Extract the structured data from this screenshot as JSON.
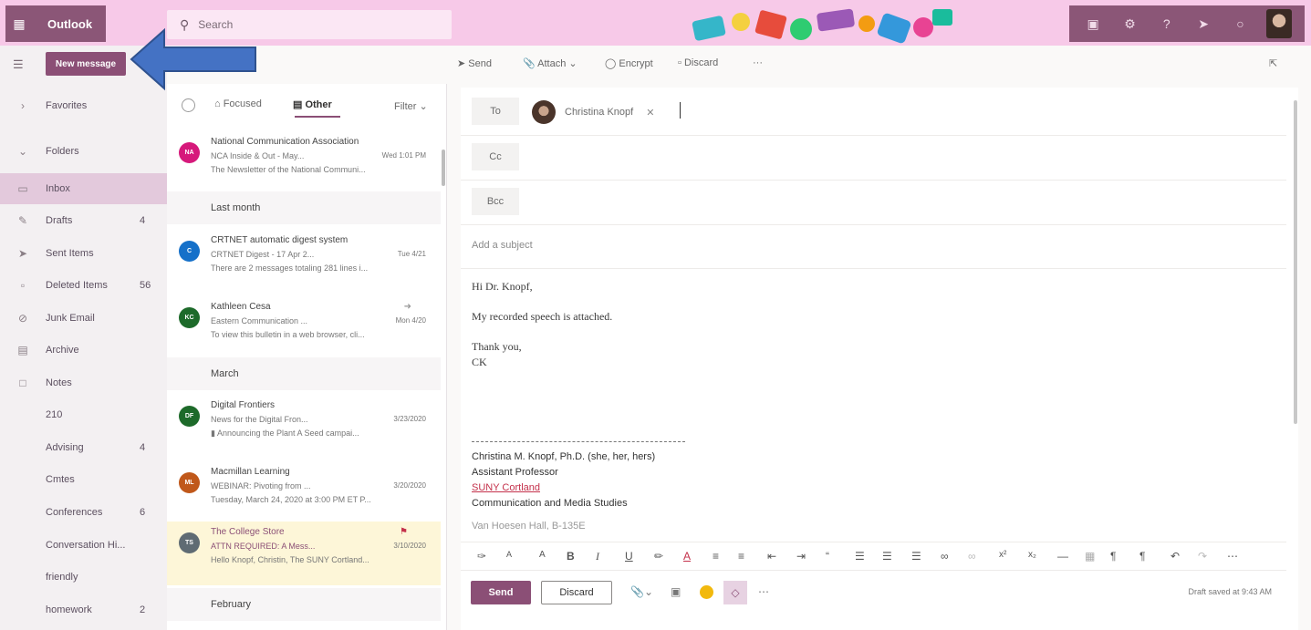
{
  "app": {
    "name": "Outlook"
  },
  "search": {
    "placeholder": "Search"
  },
  "topbar": {
    "icons": [
      "teams-icon",
      "gear-icon",
      "help-icon",
      "megaphone-icon",
      "bell-icon",
      "profile-avatar"
    ]
  },
  "leftnav": {
    "new_message": "New message",
    "items": [
      {
        "icon": "chevron-right-icon",
        "label": "Favorites",
        "count": ""
      },
      {
        "icon": "chevron-down-icon",
        "label": "Folders",
        "count": ""
      },
      {
        "icon": "inbox-icon",
        "label": "Inbox",
        "count": ""
      },
      {
        "icon": "pencil-icon",
        "label": "Drafts",
        "count": "4"
      },
      {
        "icon": "send-icon",
        "label": "Sent Items",
        "count": ""
      },
      {
        "icon": "trash-icon",
        "label": "Deleted Items",
        "count": "56"
      },
      {
        "icon": "junk-icon",
        "label": "Junk Email",
        "count": ""
      },
      {
        "icon": "archive-icon",
        "label": "Archive",
        "count": ""
      },
      {
        "icon": "note-icon",
        "label": "Notes",
        "count": ""
      },
      {
        "icon": "",
        "label": "210",
        "count": ""
      },
      {
        "icon": "",
        "label": "Advising",
        "count": "4"
      },
      {
        "icon": "",
        "label": "Cmtes",
        "count": ""
      },
      {
        "icon": "",
        "label": "Conferences",
        "count": "6"
      },
      {
        "icon": "",
        "label": "Conversation Hi...",
        "count": ""
      },
      {
        "icon": "",
        "label": "friendly",
        "count": ""
      },
      {
        "icon": "",
        "label": "homework",
        "count": "2"
      }
    ]
  },
  "msglist": {
    "tab_focused": "Focused",
    "tab_other": "Other",
    "filter": "Filter",
    "groups": {
      "last_month": "Last month",
      "march": "March",
      "february": "February"
    },
    "items": [
      {
        "initials": "NA",
        "color": "#d6197b",
        "sender": "National Communication Association",
        "subject": "NCA Inside & Out - May...",
        "date": "Wed 1:01 PM",
        "preview": "The Newsletter of the National Communi..."
      },
      {
        "initials": "C",
        "color": "#1570c9",
        "sender": "CRTNET automatic digest system",
        "subject": "CRTNET Digest - 17 Apr 2...",
        "date": "Tue 4/21",
        "preview": "There are 2 messages totaling 281 lines i..."
      },
      {
        "initials": "KC",
        "color": "#1d6a2a",
        "sender": "Kathleen Cesa",
        "subject": "Eastern Communication ...",
        "date": "Mon 4/20",
        "preview": "To view this bulletin in a web browser, cli..."
      },
      {
        "initials": "DF",
        "color": "#1d6a2a",
        "sender": "Digital Frontiers",
        "subject": "News for the Digital Fron...",
        "date": "3/23/2020",
        "preview": "Announcing the Plant A Seed campai..."
      },
      {
        "initials": "ML",
        "color": "#c0581a",
        "sender": "Macmillan Learning",
        "subject": "WEBINAR: Pivoting from ...",
        "date": "3/20/2020",
        "preview": "Tuesday, March 24, 2020 at 3:00 PM ET P..."
      },
      {
        "initials": "TS",
        "color": "#5f6b73",
        "sender": "The College Store",
        "subject": "ATTN REQUIRED: A Mess...",
        "date": "3/10/2020",
        "preview": "Hello Knopf, Christin, The SUNY Cortland..."
      }
    ]
  },
  "toolbar": {
    "send": "Send",
    "attach": "Attach",
    "encrypt": "Encrypt",
    "discard": "Discard",
    "more": "···"
  },
  "compose": {
    "to_label": "To",
    "cc_label": "Cc",
    "bcc_label": "Bcc",
    "recipient": "Christina Knopf",
    "subject_placeholder": "Add a subject",
    "body_greeting": "Hi Dr. Knopf,",
    "body_line": "My recorded speech is attached.",
    "body_closing": "Thank you,",
    "body_initials": "CK",
    "sig_name": "Christina M. Knopf, Ph.D. (she, her, hers)",
    "sig_title": "Assistant Professor",
    "sig_school": "SUNY Cortland",
    "sig_dept": "Communication and Media Studies",
    "sig_extra": "Van Hoesen Hall, B-135E",
    "send_button": "Send",
    "discard_button": "Discard",
    "draft_status": "Draft saved at 9:43 AM"
  },
  "colors": {
    "brand": "#8b4f76",
    "topbar": "#f7c9e8",
    "annotation_arrow": "#4472c4"
  }
}
